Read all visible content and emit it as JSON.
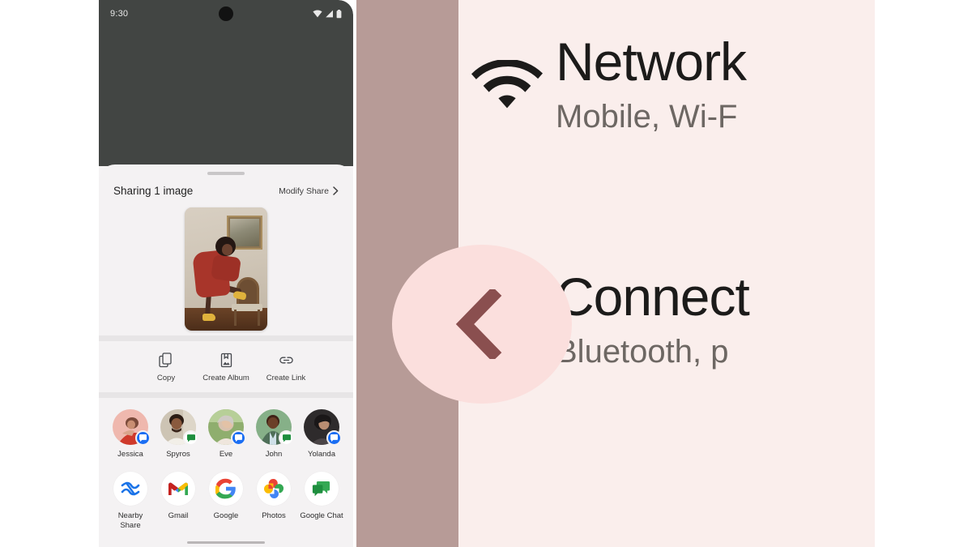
{
  "phone": {
    "status_bar": {
      "time": "9:30",
      "icons": [
        "wifi-icon",
        "cellular-signal-icon",
        "battery-icon"
      ]
    },
    "share_sheet": {
      "title": "Sharing 1 image",
      "modify_share_label": "Modify Share",
      "chevron": "chevron-right-icon",
      "preview_alt": "Person in red coat leaning on chair, framed painting on wall",
      "actions": [
        {
          "label": "Copy",
          "icon": "copy-icon"
        },
        {
          "label": "Create Album",
          "icon": "album-icon"
        },
        {
          "label": "Create Link",
          "icon": "link-icon"
        }
      ],
      "contacts": [
        {
          "name": "Jessica",
          "badge": "messages"
        },
        {
          "name": "Spyros",
          "badge": "chat"
        },
        {
          "name": "Eve",
          "badge": "messages"
        },
        {
          "name": "John",
          "badge": "chat"
        },
        {
          "name": "Yolanda",
          "badge": "messages"
        }
      ],
      "apps": [
        {
          "label": "Nearby Share",
          "icon": "nearby-share-icon"
        },
        {
          "label": "Gmail",
          "icon": "gmail-icon"
        },
        {
          "label": "Google",
          "icon": "google-icon"
        },
        {
          "label": "Photos",
          "icon": "google-photos-icon"
        },
        {
          "label": "Google Chat",
          "icon": "google-chat-icon"
        }
      ]
    }
  },
  "settings_panel": {
    "rows": [
      {
        "title": "Network",
        "subtitle": "Mobile, Wi-F",
        "icon": "wifi-icon"
      },
      {
        "title": "Connect",
        "subtitle": "Bluetooth, p",
        "icon": "connected-devices-icon"
      }
    ],
    "back_gesture": "back-chevron-icon"
  },
  "colors": {
    "edge_strip": "#b79b97",
    "panel_bg": "#faeeec",
    "back_pill": "#fbdfdd",
    "back_chevron": "#8a4f4f",
    "scrim": "#424543",
    "sheet_bg": "#f4f2f3",
    "messages_badge": "#1b6ef3",
    "chat_badge": "#1e8e3e"
  }
}
